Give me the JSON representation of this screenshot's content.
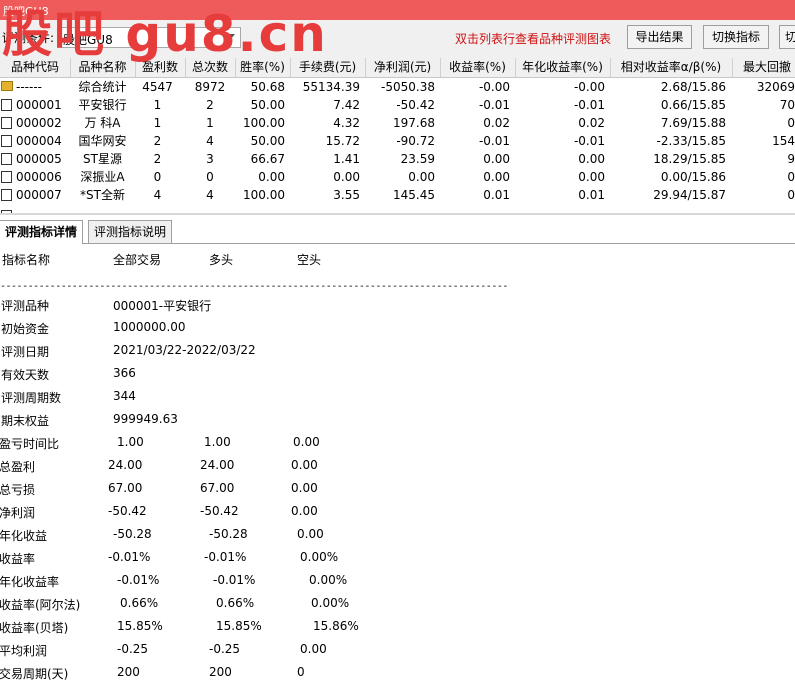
{
  "window": {
    "title": "股吧GU8"
  },
  "watermark": "股吧 gu8.cn",
  "toolbar": {
    "condition_label": "评测条件:",
    "condition_value": "股吧GU8",
    "hint": "双击列表行查看品种评测图表",
    "export_label": "导出结果",
    "switch_label": "切换指标",
    "extra_label": "切"
  },
  "table": {
    "headers": [
      "品种代码",
      "品种名称",
      "盈利数",
      "总次数",
      "胜率(%)",
      "手续费(元)",
      "净利润(元)",
      "收益率(%)",
      "年化收益率(%)",
      "相对收益率α/β(%)",
      "最大回撤"
    ],
    "rows": [
      {
        "code": "------",
        "name": "综合统计",
        "win": "4547",
        "total": "8972",
        "rate": "50.68",
        "fee": "55134.39",
        "profit": "-5050.38",
        "ret": "-0.00",
        "annual": "-0.00",
        "rel": "2.68/15.86",
        "dd": "32069"
      },
      {
        "code": "000001",
        "name": "平安银行",
        "win": "1",
        "total": "2",
        "rate": "50.00",
        "fee": "7.42",
        "profit": "-50.42",
        "ret": "-0.01",
        "annual": "-0.01",
        "rel": "0.66/15.85",
        "dd": "70"
      },
      {
        "code": "000002",
        "name": "万 科A",
        "win": "1",
        "total": "1",
        "rate": "100.00",
        "fee": "4.32",
        "profit": "197.68",
        "ret": "0.02",
        "annual": "0.02",
        "rel": "7.69/15.88",
        "dd": "0"
      },
      {
        "code": "000004",
        "name": "国华网安",
        "win": "2",
        "total": "4",
        "rate": "50.00",
        "fee": "15.72",
        "profit": "-90.72",
        "ret": "-0.01",
        "annual": "-0.01",
        "rel": "-2.33/15.85",
        "dd": "154"
      },
      {
        "code": "000005",
        "name": "ST星源",
        "win": "2",
        "total": "3",
        "rate": "66.67",
        "fee": "1.41",
        "profit": "23.59",
        "ret": "0.00",
        "annual": "0.00",
        "rel": "18.29/15.85",
        "dd": "9"
      },
      {
        "code": "000006",
        "name": "深振业A",
        "win": "0",
        "total": "0",
        "rate": "0.00",
        "fee": "0.00",
        "profit": "0.00",
        "ret": "0.00",
        "annual": "0.00",
        "rel": "0.00/15.86",
        "dd": "0"
      },
      {
        "code": "000007",
        "name": "*ST全新",
        "win": "4",
        "total": "4",
        "rate": "100.00",
        "fee": "3.55",
        "profit": "145.45",
        "ret": "0.01",
        "annual": "0.01",
        "rel": "29.94/15.87",
        "dd": "0"
      }
    ]
  },
  "tabs": [
    "评测指标详情",
    "评测指标说明"
  ],
  "detail": {
    "headers": [
      "指标名称",
      "全部交易",
      "多头",
      "空头"
    ],
    "separator": "--------------------------------------------------------------------------------------------",
    "info": [
      {
        "label": "评测品种",
        "value": "000001-平安银行"
      },
      {
        "label": "初始资金",
        "value": "1000000.00"
      },
      {
        "label": "评测日期",
        "value": "2021/03/22-2022/03/22"
      },
      {
        "label": "有效天数",
        "value": "366"
      },
      {
        "label": "评测周期数",
        "value": "344"
      },
      {
        "label": "期末权益",
        "value": "999949.63"
      }
    ],
    "metrics": [
      {
        "label": "盈亏时间比",
        "all": "1.00",
        "long": "1.00",
        "short": "0.00"
      },
      {
        "label": "总盈利",
        "all": "24.00",
        "long": "24.00",
        "short": "0.00"
      },
      {
        "label": "总亏损",
        "all": "67.00",
        "long": "67.00",
        "short": "0.00"
      },
      {
        "label": "净利润",
        "all": "-50.42",
        "long": "-50.42",
        "short": "0.00"
      },
      {
        "label": "年化收益",
        "all": "-50.28",
        "long": "-50.28",
        "short": "0.00"
      },
      {
        "label": "收益率",
        "all": "-0.01%",
        "long": "-0.01%",
        "short": "0.00%"
      },
      {
        "label": "年化收益率",
        "all": "-0.01%",
        "long": "-0.01%",
        "short": "0.00%"
      },
      {
        "label": "收益率(阿尔法)",
        "all": "0.66%",
        "long": "0.66%",
        "short": "0.00%"
      },
      {
        "label": "收益率(贝塔)",
        "all": "15.85%",
        "long": "15.85%",
        "short": "15.86%"
      },
      {
        "label": "平均利润",
        "all": "-0.25",
        "long": "-0.25",
        "short": "0.00"
      },
      {
        "label": "交易周期(天)",
        "all": "200",
        "long": "200",
        "short": "0"
      }
    ]
  },
  "colors": {
    "titlebar": "#ef5a5a",
    "hint": "#d01010",
    "watermark": "#e63c3c"
  },
  "icons": {
    "summary_row": "summary-icon",
    "stock_row": "folder-icon",
    "combo": "chevron-down-icon"
  }
}
